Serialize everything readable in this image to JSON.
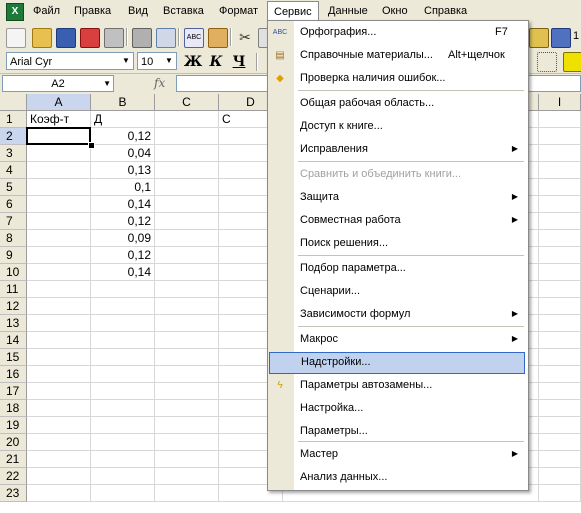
{
  "menubar": {
    "items": [
      "Файл",
      "Правка",
      "Вид",
      "Вставка",
      "Формат",
      "Сервис",
      "Данные",
      "Окно",
      "Справка"
    ],
    "active": "Сервис"
  },
  "toolbar": {
    "font_name": "Arial Cyr",
    "font_size": "10",
    "bold_label": "Ж",
    "italic_label": "К",
    "underline_label": "Ч",
    "zoom_partial": "1"
  },
  "formula": {
    "name_box": "A2",
    "fx_label": "fx",
    "value": ""
  },
  "sheet": {
    "columns": [
      "A",
      "B",
      "C",
      "D",
      "I"
    ],
    "rows": [
      "1",
      "2",
      "3",
      "4",
      "5",
      "6",
      "7",
      "8",
      "9",
      "10",
      "11",
      "12",
      "13",
      "14",
      "15",
      "16",
      "17",
      "18",
      "19",
      "20",
      "21",
      "22",
      "23"
    ],
    "header_row": {
      "A": "Коэф-т",
      "B": "Д",
      "D": "С"
    },
    "b_values": [
      "0,12",
      "0,04",
      "0,13",
      "0,1",
      "0,14",
      "0,12",
      "0,09",
      "0,12",
      "0,14"
    ],
    "active_cell": "A2"
  },
  "menu": {
    "title": "Сервис",
    "items": [
      {
        "label": "Орфография...",
        "shortcut": "F7",
        "icon": "spelling-icon"
      },
      {
        "label": "Справочные материалы...",
        "shortcut": "Alt+щелчок",
        "icon": "research-icon"
      },
      {
        "label": "Проверка наличия ошибок...",
        "icon": "error-check-icon"
      },
      {
        "label": "Общая рабочая область..."
      },
      {
        "label": "Доступ к книге..."
      },
      {
        "label": "Исправления",
        "submenu": true
      },
      {
        "label": "Сравнить и объединить книги...",
        "disabled": true
      },
      {
        "label": "Защита",
        "submenu": true
      },
      {
        "label": "Совместная работа",
        "submenu": true
      },
      {
        "label": "Поиск решения..."
      },
      {
        "label": "Подбор параметра..."
      },
      {
        "label": "Сценарии..."
      },
      {
        "label": "Зависимости формул",
        "submenu": true
      },
      {
        "label": "Макрос",
        "submenu": true
      },
      {
        "label": "Надстройки...",
        "highlighted": true
      },
      {
        "label": "Параметры автозамены...",
        "icon": "autocorrect-icon"
      },
      {
        "label": "Настройка..."
      },
      {
        "label": "Параметры..."
      },
      {
        "label": "Мастер",
        "submenu": true
      },
      {
        "label": "Анализ данных..."
      }
    ]
  },
  "colors": {
    "chrome": "#ece9d8",
    "menu_highlight": "#c1d2ee",
    "menu_highlight_border": "#316ac5",
    "header_selected": "#c9d6ed"
  }
}
